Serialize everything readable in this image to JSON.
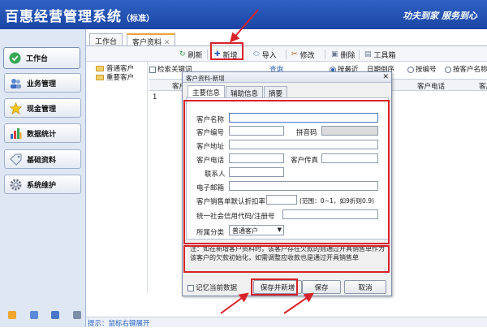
{
  "app": {
    "title": "百惠经营管理系统",
    "edition": "（标准）",
    "slogan": "功夫到家  服务到心"
  },
  "sidebar": {
    "items": [
      {
        "label": "工作台",
        "icon": "check-circle-icon"
      },
      {
        "label": "业务管理",
        "icon": "people-icon"
      },
      {
        "label": "现金管理",
        "icon": "star-icon"
      },
      {
        "label": "数据统计",
        "icon": "bar-chart-icon"
      },
      {
        "label": "基础资料",
        "icon": "tag-icon"
      },
      {
        "label": "系统维护",
        "icon": "gear-icon"
      }
    ]
  },
  "tabs": [
    "工作台",
    "客户资料"
  ],
  "toolbar": {
    "refresh": "刷新",
    "new": "新增",
    "import": "导入",
    "edit": "修改",
    "delete": "删除",
    "toolbox": "工具箱"
  },
  "tree": {
    "items": [
      "普通客户",
      "重要客户"
    ]
  },
  "search": {
    "keyword_label": "检索关键词",
    "query_label": "查询",
    "sort_recent": "按最近",
    "sort_date_desc": "日期倒序",
    "sort_code": "按编号",
    "sort_name": "按客户名称"
  },
  "grid": {
    "headers": [
      "客户",
      "客户电话",
      "客户"
    ],
    "row_number": "1"
  },
  "status_hint": "提示：鼠标右键展开",
  "dialog": {
    "title": "客户资料-新增",
    "tabs": [
      "主要信息",
      "辅助信息",
      "摘要"
    ],
    "fields": {
      "name": "客户名称",
      "code": "客户编号",
      "pinyin": "拼音码",
      "address": "客户地址",
      "phone": "客户电话",
      "fax": "客户传真",
      "contact": "联系人",
      "email": "电子邮箱",
      "discount": "客户销售单默认折扣率",
      "discount_hint": "(范围：0~1，如9折则0.9)",
      "credit_code": "统一社会信用代码/注册号",
      "category": "所属分类",
      "category_value": "普通客户"
    },
    "note": "注：如在新增客户资料时，该客户存在欠款的则通过开具销售单作为该客户的欠款初始化，如需调整应收款也是通过开具销售单",
    "remember": "记忆当前数据",
    "buttons": {
      "save_new": "保存并新增",
      "save": "保存",
      "cancel": "取消"
    }
  }
}
